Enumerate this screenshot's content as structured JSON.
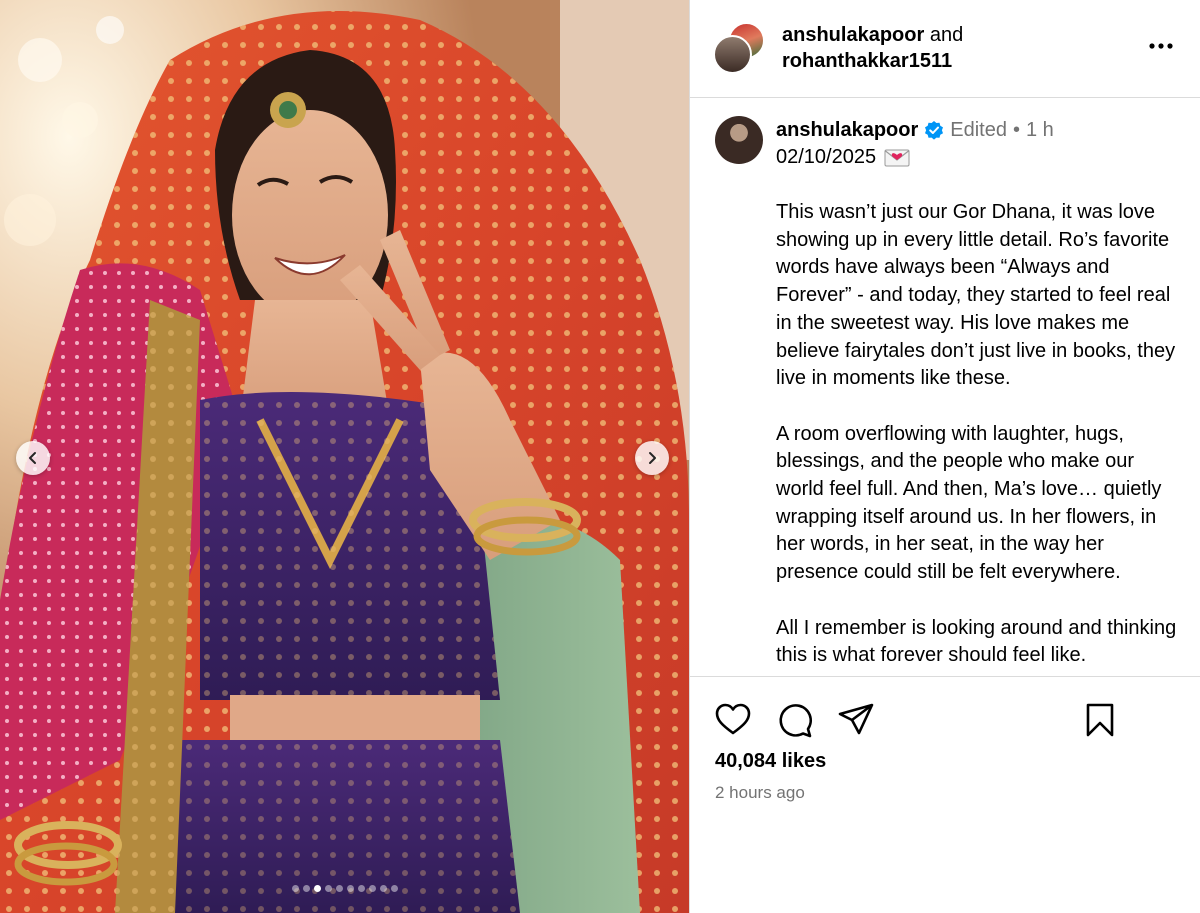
{
  "header": {
    "user1": "anshulakapoor",
    "and_text": "and",
    "user2": "rohanthakkar1511"
  },
  "icons": {
    "more": "more-horizontal-icon",
    "prev": "chevron-left-icon",
    "next": "chevron-right-icon",
    "verified": "verified-badge-icon",
    "envelope": "love-letter-emoji",
    "like": "heart-icon",
    "comment": "comment-icon",
    "share": "send-icon",
    "save": "bookmark-icon"
  },
  "caption": {
    "username": "anshulakapoor",
    "edited": "Edited",
    "separator": "•",
    "age": "1 h",
    "date": "02/10/2025",
    "paragraph1": "This wasn’t just our Gor Dhana, it was love showing up in every little detail. Ro’s favorite words have always been “Always and Forever” - and today, they started to feel real in the sweetest way. His love makes me believe fairytales don’t just live in books, they live in moments like these.",
    "paragraph2": "A room overflowing with laughter, hugs, blessings, and the people who make our world feel full. And then, Ma’s love… quietly wrapping itself around us. In her flowers, in her words, in her seat, in the way her presence could still be felt everywhere.",
    "paragraph3": "All I remember is looking around and thinking this is what forever should feel like."
  },
  "footer": {
    "likes": "40,084 likes",
    "posted": "2 hours ago"
  },
  "carousel": {
    "total_slides": 10,
    "active_slide": 3
  },
  "colors": {
    "border": "#dbdbdb",
    "muted_text": "#737373",
    "verified_blue": "#0095f6"
  }
}
